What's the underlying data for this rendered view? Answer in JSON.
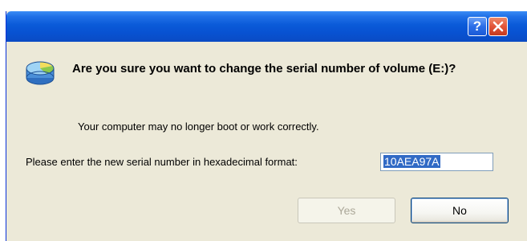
{
  "dialog": {
    "help_glyph": "?",
    "question": "Are you sure you want to change the serial number of volume (E:)?",
    "warning": "Your computer may no longer boot or work correctly.",
    "prompt_label": "Please enter the new serial number in hexadecimal format:",
    "serial_value": "10AEA97A",
    "yes_label": "Yes",
    "no_label": "No",
    "yes_enabled": false,
    "icons": {
      "help": "help-icon",
      "close": "close-icon",
      "volume": "disk-volume-icon"
    },
    "colors": {
      "titlebar": "#0a5ad8",
      "close_button": "#e2553a",
      "dialog_bg": "#ece9d8",
      "selection": "#316ac5"
    }
  }
}
